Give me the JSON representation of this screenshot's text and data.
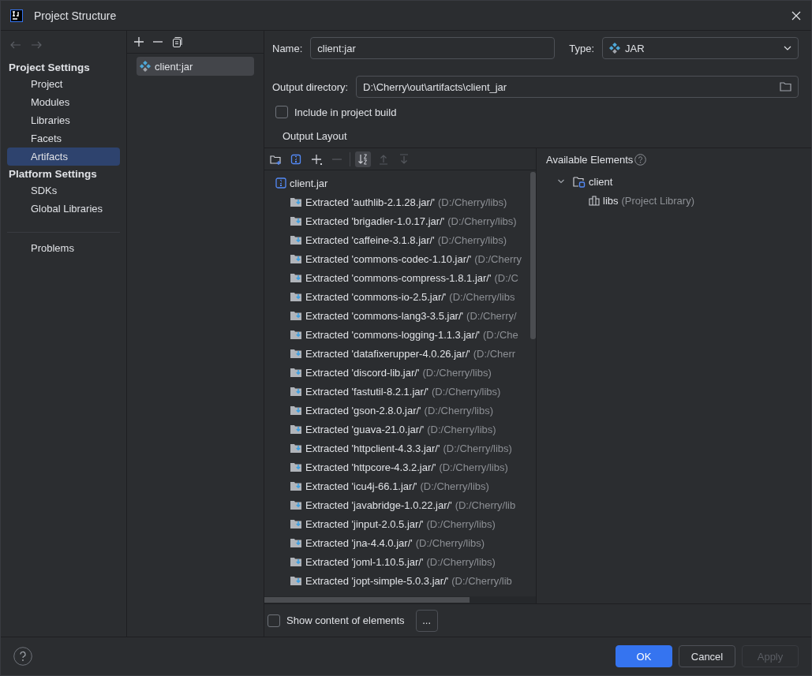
{
  "window": {
    "title": "Project Structure"
  },
  "sidebar": {
    "sections": [
      {
        "title": "Project Settings",
        "items": [
          {
            "label": "Project",
            "selected": false
          },
          {
            "label": "Modules",
            "selected": false
          },
          {
            "label": "Libraries",
            "selected": false
          },
          {
            "label": "Facets",
            "selected": false
          },
          {
            "label": "Artifacts",
            "selected": true
          }
        ]
      },
      {
        "title": "Platform Settings",
        "items": [
          {
            "label": "SDKs",
            "selected": false
          },
          {
            "label": "Global Libraries",
            "selected": false
          }
        ]
      }
    ],
    "footer_items": [
      {
        "label": "Problems",
        "selected": false
      }
    ]
  },
  "artifacts": [
    {
      "label": "client:jar",
      "selected": true
    }
  ],
  "form": {
    "name_label": "Name:",
    "name_value": "client:jar",
    "type_label": "Type:",
    "type_value": "JAR",
    "output_label": "Output directory:",
    "output_value": "D:\\Cherry\\out\\artifacts\\client_jar",
    "include_label": "Include in project build",
    "include_checked": false,
    "layout_title": "Output Layout"
  },
  "toolbar": [
    {
      "kind": "new-folder",
      "on": false,
      "disabled": false
    },
    {
      "kind": "archive",
      "on": false,
      "disabled": false
    },
    {
      "kind": "add",
      "on": false,
      "disabled": false
    },
    {
      "kind": "remove",
      "on": false,
      "disabled": true
    },
    {
      "kind": "sort",
      "on": true,
      "disabled": false
    },
    {
      "kind": "up",
      "on": false,
      "disabled": true
    },
    {
      "kind": "down",
      "on": false,
      "disabled": true
    }
  ],
  "output_tree": {
    "label": "client.jar",
    "children": [
      {
        "label": "Extracted 'authlib-2.1.28.jar/'",
        "path": "(D:/Cherry/libs)"
      },
      {
        "label": "Extracted 'brigadier-1.0.17.jar/'",
        "path": "(D:/Cherry/libs)"
      },
      {
        "label": "Extracted 'caffeine-3.1.8.jar/'",
        "path": "(D:/Cherry/libs)"
      },
      {
        "label": "Extracted 'commons-codec-1.10.jar/'",
        "path": "(D:/Cherry"
      },
      {
        "label": "Extracted 'commons-compress-1.8.1.jar/'",
        "path": "(D:/C"
      },
      {
        "label": "Extracted 'commons-io-2.5.jar/'",
        "path": "(D:/Cherry/libs"
      },
      {
        "label": "Extracted 'commons-lang3-3.5.jar/'",
        "path": "(D:/Cherry/"
      },
      {
        "label": "Extracted 'commons-logging-1.1.3.jar/'",
        "path": "(D:/Che"
      },
      {
        "label": "Extracted 'datafixerupper-4.0.26.jar/'",
        "path": "(D:/Cherr"
      },
      {
        "label": "Extracted 'discord-lib.jar/'",
        "path": "(D:/Cherry/libs)"
      },
      {
        "label": "Extracted 'fastutil-8.2.1.jar/'",
        "path": "(D:/Cherry/libs)"
      },
      {
        "label": "Extracted 'gson-2.8.0.jar/'",
        "path": "(D:/Cherry/libs)"
      },
      {
        "label": "Extracted 'guava-21.0.jar/'",
        "path": "(D:/Cherry/libs)"
      },
      {
        "label": "Extracted 'httpclient-4.3.3.jar/'",
        "path": "(D:/Cherry/libs)"
      },
      {
        "label": "Extracted 'httpcore-4.3.2.jar/'",
        "path": "(D:/Cherry/libs)"
      },
      {
        "label": "Extracted 'icu4j-66.1.jar/'",
        "path": "(D:/Cherry/libs)"
      },
      {
        "label": "Extracted 'javabridge-1.0.22.jar/'",
        "path": "(D:/Cherry/lib"
      },
      {
        "label": "Extracted 'jinput-2.0.5.jar/'",
        "path": "(D:/Cherry/libs)"
      },
      {
        "label": "Extracted 'jna-4.4.0.jar/'",
        "path": "(D:/Cherry/libs)"
      },
      {
        "label": "Extracted 'joml-1.10.5.jar/'",
        "path": "(D:/Cherry/libs)"
      },
      {
        "label": "Extracted 'jopt-simple-5.0.3.jar/'",
        "path": "(D:/Cherry/lib"
      }
    ]
  },
  "available": {
    "title": "Available Elements",
    "tree": [
      {
        "label": "client",
        "expanded": true,
        "children": [
          {
            "label": "libs",
            "note": "(Project Library)"
          }
        ]
      }
    ]
  },
  "show_content": {
    "label": "Show content of elements",
    "checked": false,
    "button": "..."
  },
  "buttons": [
    {
      "label": "OK",
      "kind": "primary",
      "disabled": false
    },
    {
      "label": "Cancel",
      "kind": "normal",
      "disabled": false
    },
    {
      "label": "Apply",
      "kind": "normal",
      "disabled": true
    }
  ]
}
